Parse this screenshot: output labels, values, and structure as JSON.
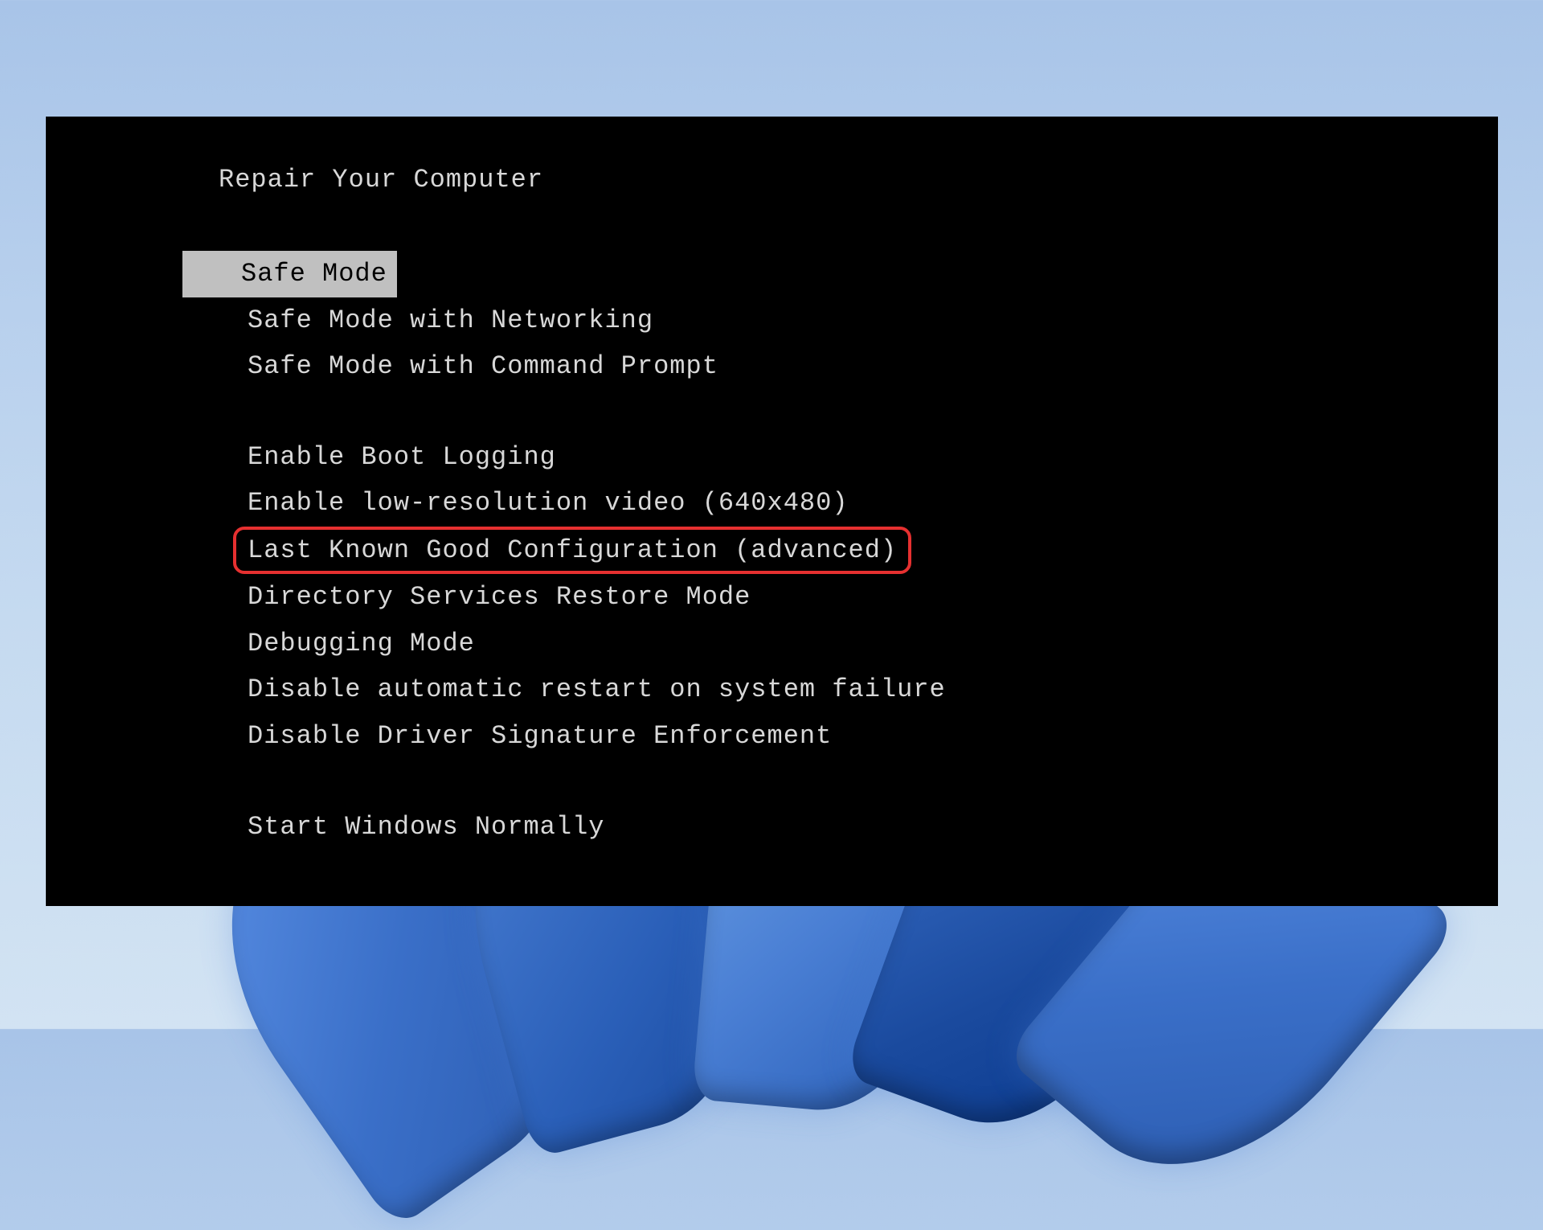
{
  "boot_menu": {
    "title": "Repair Your Computer",
    "groups": [
      {
        "items": [
          {
            "label": "Safe Mode",
            "selected": true,
            "highlighted": false
          },
          {
            "label": "Safe Mode with Networking",
            "selected": false,
            "highlighted": false
          },
          {
            "label": "Safe Mode with Command Prompt",
            "selected": false,
            "highlighted": false
          }
        ]
      },
      {
        "items": [
          {
            "label": "Enable Boot Logging",
            "selected": false,
            "highlighted": false
          },
          {
            "label": "Enable low-resolution video (640x480)",
            "selected": false,
            "highlighted": false
          },
          {
            "label": "Last Known Good Configuration (advanced)",
            "selected": false,
            "highlighted": true
          },
          {
            "label": "Directory Services Restore Mode",
            "selected": false,
            "highlighted": false
          },
          {
            "label": "Debugging Mode",
            "selected": false,
            "highlighted": false
          },
          {
            "label": "Disable automatic restart on system failure",
            "selected": false,
            "highlighted": false
          },
          {
            "label": "Disable Driver Signature Enforcement",
            "selected": false,
            "highlighted": false
          }
        ]
      },
      {
        "items": [
          {
            "label": "Start Windows Normally",
            "selected": false,
            "highlighted": false
          }
        ]
      }
    ]
  }
}
